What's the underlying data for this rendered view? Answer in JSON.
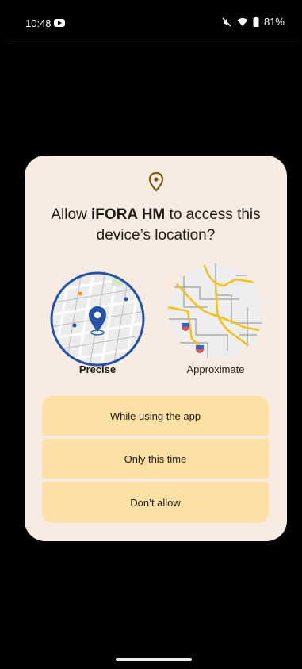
{
  "status": {
    "time": "10:48",
    "battery": "81%"
  },
  "dialog": {
    "title_prefix": "Allow ",
    "app_name": "iFORA HM",
    "title_suffix": " to access this device’s location?",
    "options": {
      "precise": "Precise",
      "approximate": "Approximate"
    },
    "buttons": {
      "while_using": "While using the app",
      "only_this_time": "Only this time",
      "dont_allow": "Don’t allow"
    }
  },
  "colors": {
    "dialog_bg": "#f8ebe1",
    "button_bg": "#fde1a4",
    "location_icon": "#7a5b14",
    "precise_ring": "#2452a6",
    "road_yellow": "#f4c21d"
  },
  "icons": [
    "youtube-icon",
    "mute-icon",
    "wifi-icon",
    "battery-icon",
    "location-pin-icon"
  ]
}
